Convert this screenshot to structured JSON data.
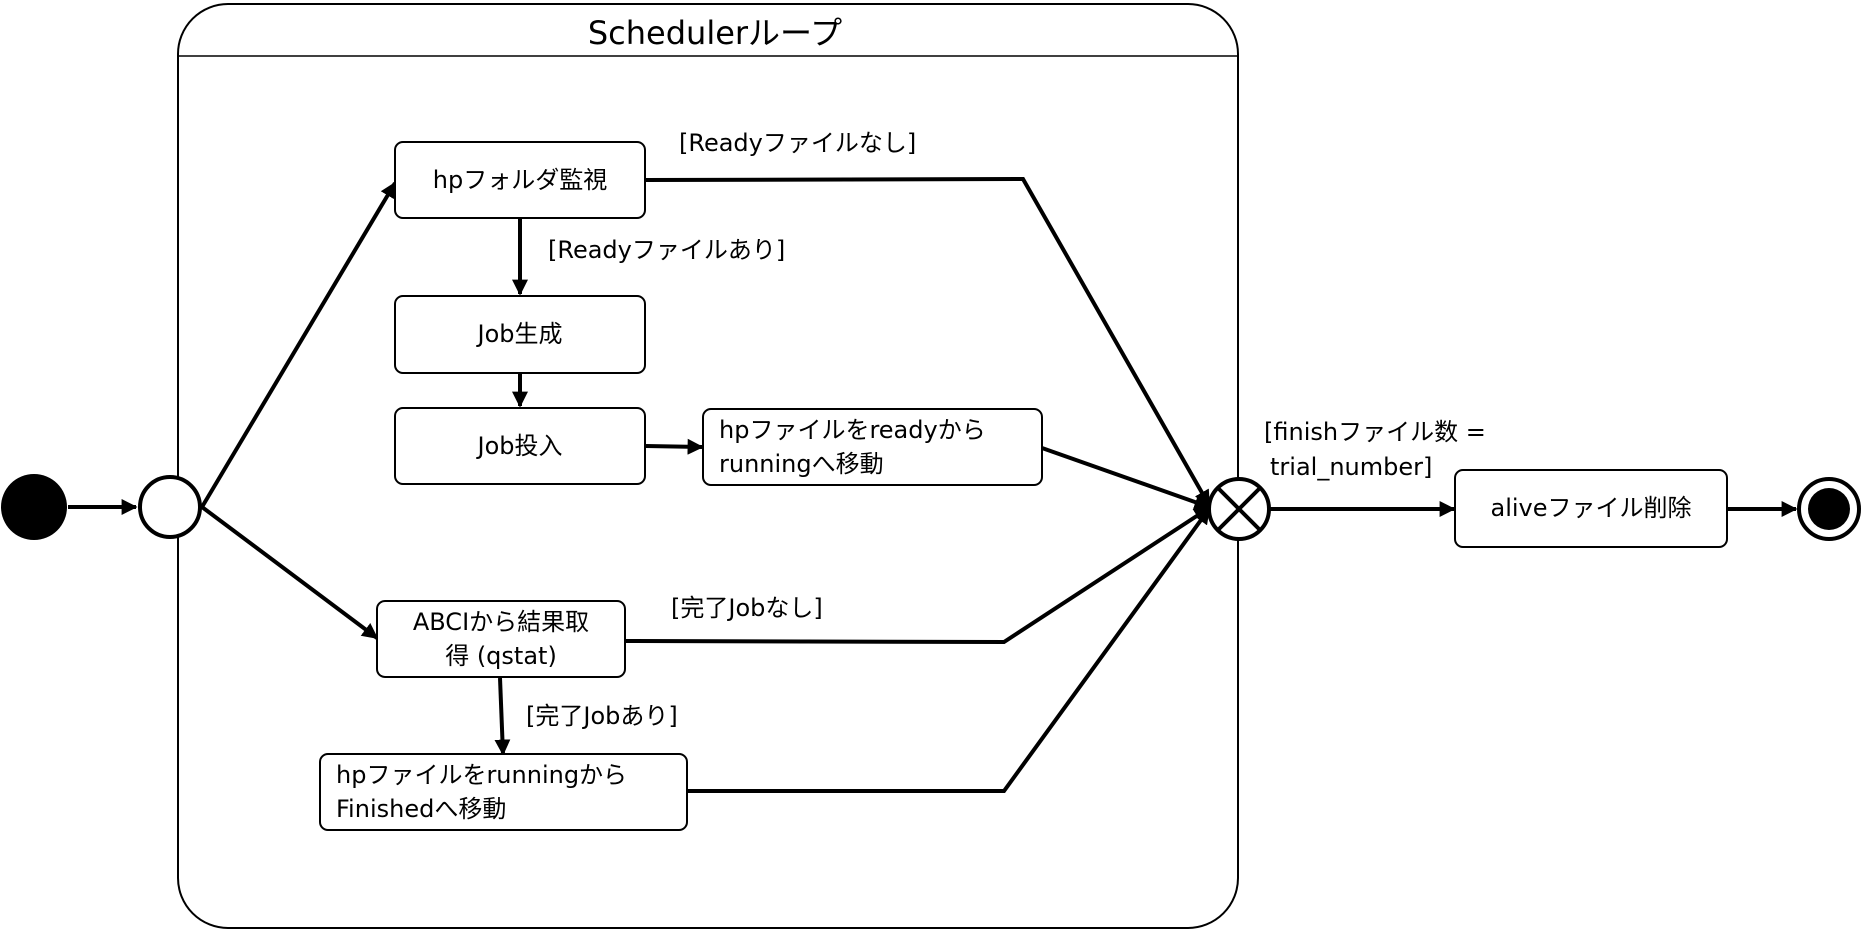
{
  "container": {
    "title": "Schedulerループ"
  },
  "nodes": {
    "hp_watch": {
      "label": "hpフォルダ監視"
    },
    "job_create": {
      "label": "Job生成"
    },
    "job_submit": {
      "label": "Job投入"
    },
    "move_running": {
      "lines": [
        "hpファイルをreadyから",
        "runningへ移動"
      ]
    },
    "abci_fetch": {
      "lines": [
        "ABCIから結果取",
        "得 (qstat)"
      ]
    },
    "move_finished": {
      "lines": [
        "hpファイルをrunningから",
        "Finishedへ移動"
      ]
    },
    "alive_delete": {
      "label": "aliveファイル削除"
    }
  },
  "guards": {
    "ready_none": "[Readyファイルなし]",
    "ready_exists": "[Readyファイルあり]",
    "done_none": "[完了Jobなし]",
    "done_exists": "[完了Jobあり]",
    "finish_line1": "[finishファイル数 =",
    "finish_line2": "trial_number]"
  }
}
